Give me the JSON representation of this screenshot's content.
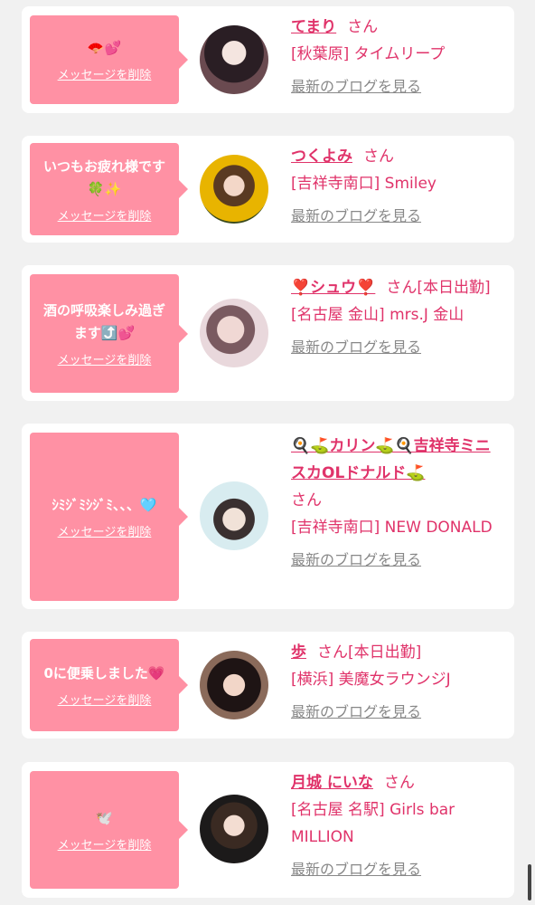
{
  "delete_label": "メッセージを削除",
  "san": "さん",
  "blog_label": "最新のブログを見る",
  "colors": {
    "accent": "#e0336a",
    "bubble": "#ff91a4"
  },
  "cards": [
    {
      "msg": "🪭💕",
      "name": "てまり",
      "tail": "",
      "shop": "[秋葉原] タイムリープ"
    },
    {
      "msg": "いつもお疲れ様です🍀✨",
      "name": "つくよみ",
      "tail": "",
      "shop": "[吉祥寺南口] Smiley"
    },
    {
      "msg": "酒の呼吸楽しみ過ぎます⤴️💕",
      "name": "❣️シュウ❣️",
      "tail": "[本日出勤]",
      "shop": "[名古屋 金山] mrs.J 金山"
    },
    {
      "msg": "ｼﾐｼﾞﾐｼｼﾞﾐ、、、🩵",
      "name": "🍳⛳カリン⛳🍳吉祥寺ミニスカOLドナルド⛳",
      "tail": "",
      "shop": "[吉祥寺南口] NEW DONALD"
    },
    {
      "msg": "0に便乗しました💗",
      "name": "歩",
      "tail": "[本日出勤]",
      "shop": "[横浜] 美魔女ラウンジJ"
    },
    {
      "msg": "🕊️",
      "name": "月城 にいな",
      "tail": "",
      "shop": "[名古屋 名駅] Girls bar MILLION"
    }
  ]
}
